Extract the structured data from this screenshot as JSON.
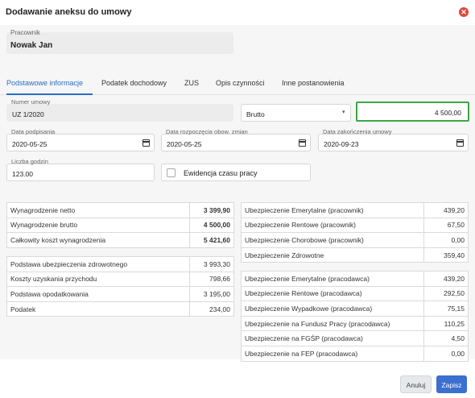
{
  "dialog": {
    "title": "Dodawanie aneksu do umowy"
  },
  "employee": {
    "label": "Pracownik",
    "value": "Nowak Jan"
  },
  "tabs": [
    {
      "label": "Podstawowe informacje",
      "active": true
    },
    {
      "label": "Podatek dochodowy"
    },
    {
      "label": "ZUS"
    },
    {
      "label": "Opis czynności"
    },
    {
      "label": "Inne postanowienia"
    }
  ],
  "form": {
    "contract_number": {
      "label": "Numer umowy",
      "value": "UZ 1/2020"
    },
    "gross_type": {
      "value": "Brutto"
    },
    "amount": {
      "value": "4 500,00"
    },
    "signing_date": {
      "label": "Data podpisania",
      "value": "2020-05-25"
    },
    "start_date": {
      "label": "Data rozpoczęcia obow. zmian",
      "value": "2020-05-25"
    },
    "end_date": {
      "label": "Data zakończenia umowy",
      "value": "2020-09-23"
    },
    "hours": {
      "label": "Liczba godzin",
      "value": "123.00"
    },
    "time_tracking": {
      "label": "Ewidencja czasu pracy",
      "checked": false
    }
  },
  "summary_table_1": [
    {
      "label": "Wynagrodzenie netto",
      "value": "3 399,90"
    },
    {
      "label": "Wynagrodzenie brutto",
      "value": "4 500,00"
    },
    {
      "label": "Całkowity koszt wynagrodzenia",
      "value": "5 421,60"
    }
  ],
  "summary_table_2": [
    {
      "label": "Podstawa ubezpieczenia zdrowotnego",
      "value": "3 993,30"
    },
    {
      "label": "Koszty uzyskania przychodu",
      "value": "798,66"
    },
    {
      "label": "Podstawa opodatkowania",
      "value": "3 195,00"
    },
    {
      "label": "Podatek",
      "value": "234,00"
    }
  ],
  "employee_insurance": [
    {
      "label": "Ubezpieczenie Emerytalne (pracownik)",
      "value": "439,20"
    },
    {
      "label": "Ubezpieczenie Rentowe (pracownik)",
      "value": "67,50"
    },
    {
      "label": "Ubezpieczenie Chorobowe (pracownik)",
      "value": "0,00"
    },
    {
      "label": "Ubezpieczenie Zdrowotne",
      "value": "359,40"
    }
  ],
  "employer_insurance": [
    {
      "label": "Ubezpieczenie Emerytalne (pracodawca)",
      "value": "439,20"
    },
    {
      "label": "Ubezpieczenie Rentowe (pracodawca)",
      "value": "292,50"
    },
    {
      "label": "Ubezpieczenie Wypadkowe (pracodawca)",
      "value": "75,15"
    },
    {
      "label": "Ubezpieczenie na Fundusz Pracy (pracodawca)",
      "value": "110,25"
    },
    {
      "label": "Ubezpieczenie na FGŚP (pracodawca)",
      "value": "4,50"
    },
    {
      "label": "Ubezpieczenie na FEP (pracodawca)",
      "value": "0,00"
    }
  ],
  "footer": {
    "cancel_label": "Anuluj",
    "save_label": "Zapisz"
  },
  "colors": {
    "accent": "#2a6fc4",
    "highlight": "#3aa842",
    "close": "#e2453c",
    "save_button": "#3b6fd0"
  },
  "icons": {
    "close": "close-icon",
    "calendar": "calendar-icon",
    "dropdown": "chevron-down-icon"
  }
}
